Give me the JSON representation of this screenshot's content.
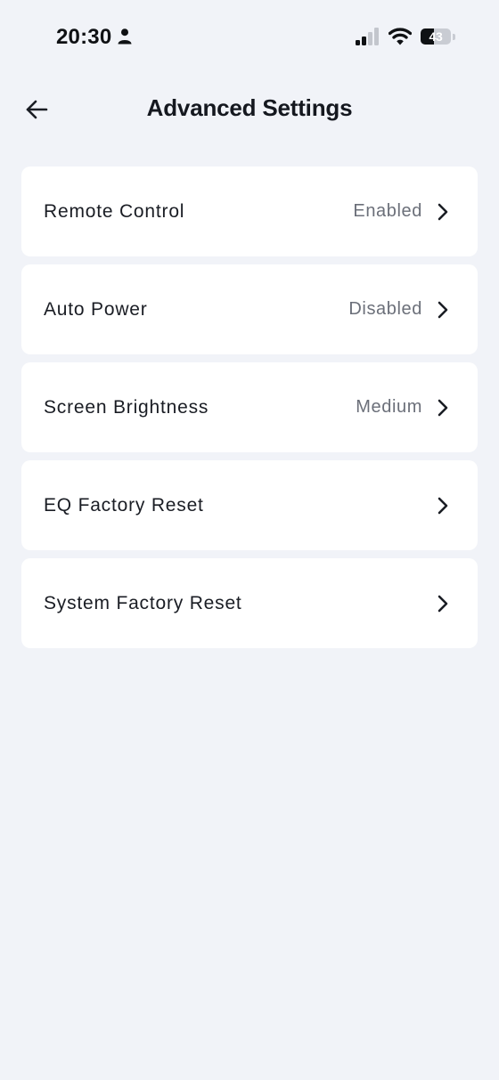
{
  "status_bar": {
    "time": "20:30",
    "battery_level": "43",
    "battery_fraction": 0.43
  },
  "header": {
    "title": "Advanced Settings"
  },
  "settings": [
    {
      "label": "Remote Control",
      "value": "Enabled"
    },
    {
      "label": "Auto Power",
      "value": "Disabled"
    },
    {
      "label": "Screen Brightness",
      "value": "Medium"
    },
    {
      "label": "EQ Factory Reset",
      "value": ""
    },
    {
      "label": "System Factory Reset",
      "value": ""
    }
  ],
  "icons": {
    "back": "arrow-left-icon",
    "chevron": "chevron-right-icon",
    "person": "person-icon",
    "signal": "cellular-signal-icon",
    "wifi": "wifi-icon",
    "battery": "battery-icon"
  },
  "colors": {
    "background": "#F1F3F8",
    "card": "#FFFFFF",
    "text_primary": "#1A1D24",
    "text_secondary": "#6B6F79"
  }
}
